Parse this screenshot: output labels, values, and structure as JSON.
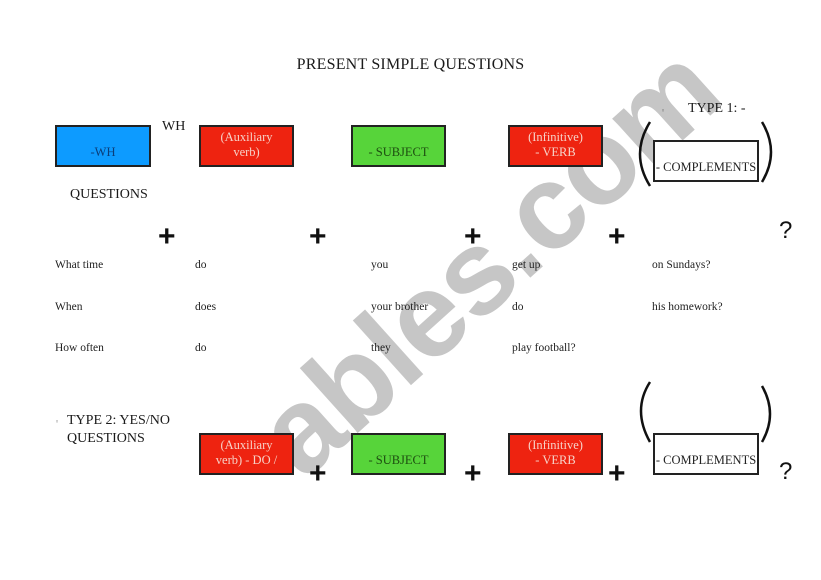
{
  "page": {
    "title": "PRESENT SIMPLE QUESTIONS",
    "watermark": "ables.com"
  },
  "type1": {
    "heading": "TYPE 1: -",
    "wh_label": "WH",
    "questions_label": "QUESTIONS",
    "boxes": {
      "wh": {
        "text": "-WH",
        "color": "#0d9bff"
      },
      "auxiliary": {
        "line1": "(Auxiliary",
        "line2": "verb)",
        "color": "#ee2310"
      },
      "subject": {
        "text": "- SUBJECT",
        "color": "#57d43a"
      },
      "verb": {
        "line1": "(Infinitive)",
        "line2": "- VERB",
        "color": "#ee2310"
      },
      "complements": {
        "text": "- COMPLEMENTS",
        "color": "#ffffff"
      }
    },
    "operators": {
      "plus": "+",
      "question_mark": "?"
    },
    "examples": [
      {
        "wh": "What time",
        "auxiliary": "do",
        "subject": "you",
        "verb": "get up",
        "complements": "on Sundays?"
      },
      {
        "wh": "When",
        "auxiliary": "does",
        "subject": "your brother",
        "verb": "do",
        "complements": "his homework?"
      },
      {
        "wh": "How often",
        "auxiliary": "do",
        "subject": "they",
        "verb": "play football?",
        "complements": ""
      }
    ]
  },
  "type2": {
    "heading_line1": "TYPE 2: YES/NO",
    "heading_line2": "QUESTIONS",
    "boxes": {
      "auxiliary": {
        "line1": "(Auxiliary",
        "line2": "verb) - DO /",
        "color": "#ee2310"
      },
      "subject": {
        "text": "- SUBJECT",
        "color": "#57d43a"
      },
      "verb": {
        "line1": "(Infinitive)",
        "line2": "- VERB",
        "color": "#ee2310"
      },
      "complements": {
        "text": "- COMPLEMENTS",
        "color": "#ffffff"
      }
    },
    "operators": {
      "plus": "+",
      "question_mark": "?"
    }
  },
  "bullet": "◦"
}
